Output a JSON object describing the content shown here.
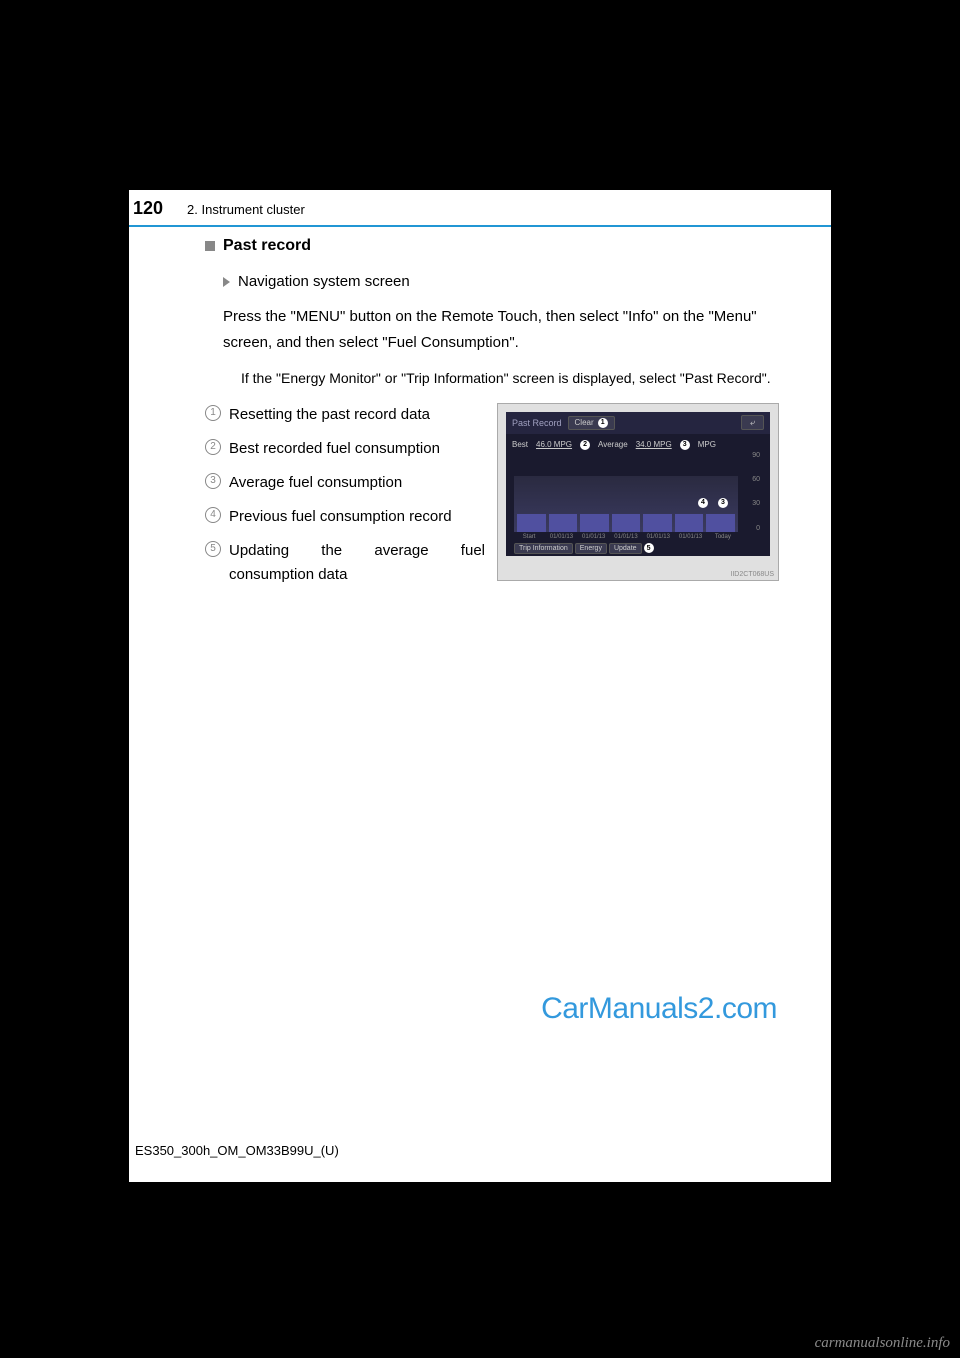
{
  "header": {
    "page_number": "120",
    "section": "2. Instrument cluster"
  },
  "heading": "Past record",
  "sub_heading": "Navigation system screen",
  "instruction": "Press the \"MENU\" button on the Remote Touch, then select \"Info\" on the \"Menu\" screen, and then select \"Fuel Consumption\".",
  "note": "If the \"Energy Monitor\" or \"Trip Information\" screen is displayed, select \"Past Record\".",
  "items": [
    {
      "num": "1",
      "text": "Resetting the past record data"
    },
    {
      "num": "2",
      "text": "Best recorded fuel consumption"
    },
    {
      "num": "3",
      "text": "Average fuel consumption"
    },
    {
      "num": "4",
      "text": "Previous fuel consumption record"
    },
    {
      "num": "5",
      "text": "Updating the average fuel consumption data"
    }
  ],
  "screenshot": {
    "title": "Past Record",
    "clear": "Clear",
    "back": "⤶",
    "best_label": "Best",
    "best_value": "46.0 MPG",
    "avg_label": "Average",
    "avg_value": "34.0 MPG",
    "unit_label": "MPG",
    "axis": [
      "90",
      "60",
      "30",
      "0"
    ],
    "dates": [
      "Start",
      "01/01/13",
      "01/01/13",
      "01/01/13",
      "01/01/13",
      "01/01/13",
      "Today"
    ],
    "tabs": [
      "Trip Information",
      "Energy",
      "Update"
    ],
    "callouts": {
      "c1": "1",
      "c2": "2",
      "c3": "3",
      "c4": "4",
      "c5": "5"
    },
    "img_code": "IID2CT068US"
  },
  "watermark": "CarManuals2.com",
  "doc_code": "ES350_300h_OM_OM33B99U_(U)",
  "bottom_watermark": "carmanualsonline.info"
}
